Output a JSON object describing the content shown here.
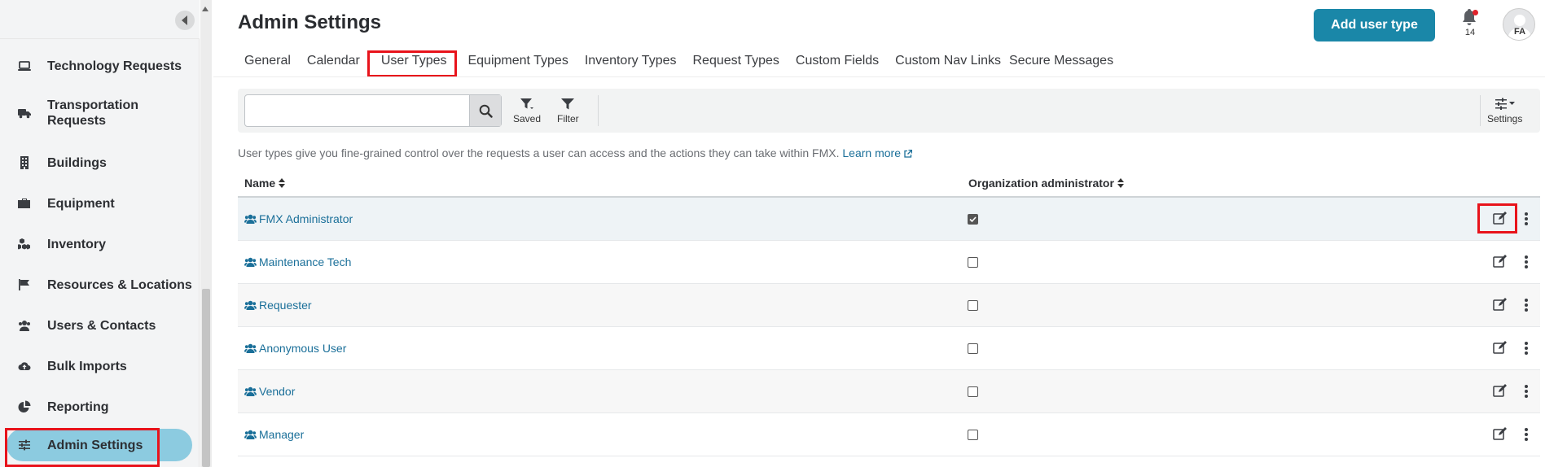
{
  "sidebar": {
    "items": [
      {
        "label": "Technology Requests",
        "icon": "laptop-icon"
      },
      {
        "label": "Transportation Requests",
        "icon": "truck-icon"
      },
      {
        "label": "Buildings",
        "icon": "building-icon"
      },
      {
        "label": "Equipment",
        "icon": "toolbox-icon"
      },
      {
        "label": "Inventory",
        "icon": "cubes-icon"
      },
      {
        "label": "Resources & Locations",
        "icon": "flag-icon"
      },
      {
        "label": "Users & Contacts",
        "icon": "users-icon"
      },
      {
        "label": "Bulk Imports",
        "icon": "cloud-upload-icon"
      },
      {
        "label": "Reporting",
        "icon": "pie-chart-icon"
      },
      {
        "label": "Admin Settings",
        "icon": "sliders-icon",
        "active": true
      }
    ]
  },
  "header": {
    "title": "Admin Settings",
    "add_button_label": "Add user type",
    "notification_count": "14",
    "avatar_initials": "FA"
  },
  "tabs": [
    {
      "label": "General"
    },
    {
      "label": "Calendar"
    },
    {
      "label": "User Types",
      "active": true
    },
    {
      "label": "Equipment Types"
    },
    {
      "label": "Inventory Types"
    },
    {
      "label": "Request Types"
    },
    {
      "label": "Custom Fields"
    },
    {
      "label": "Custom Nav Links"
    },
    {
      "label": "Secure Messages"
    }
  ],
  "toolbar": {
    "search_value": "",
    "saved_label": "Saved",
    "filter_label": "Filter",
    "settings_label": "Settings"
  },
  "info": {
    "text": "User types give you fine-grained control over the requests a user can access and the actions they can take within FMX.",
    "link": "Learn more"
  },
  "table": {
    "columns": [
      "Name",
      "Organization administrator"
    ],
    "rows": [
      {
        "name": "FMX Administrator",
        "org_admin": true
      },
      {
        "name": "Maintenance Tech",
        "org_admin": false
      },
      {
        "name": "Requester",
        "org_admin": false
      },
      {
        "name": "Anonymous User",
        "org_admin": false
      },
      {
        "name": "Vendor",
        "org_admin": false
      },
      {
        "name": "Manager",
        "org_admin": false
      }
    ]
  },
  "colors": {
    "accent": "#1a87a8",
    "link": "#1a6f99",
    "active_nav": "#8ccbe0",
    "annotation": "#e8131b"
  }
}
